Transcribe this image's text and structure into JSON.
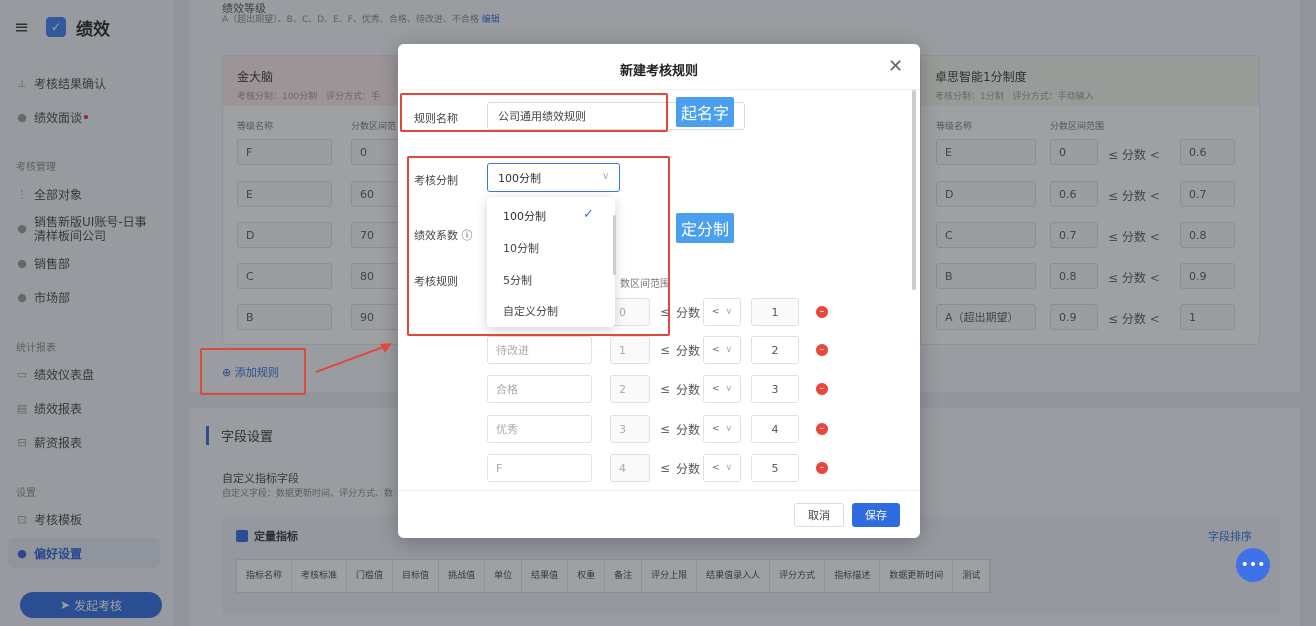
{
  "sidebar": {
    "app_title": "绩效",
    "items": [
      {
        "label": "考核结果确认",
        "icon": "stamp-icon"
      },
      {
        "label": "绩效面谈",
        "icon": "chat-icon"
      },
      {
        "label": "全部对象",
        "icon": "grid-icon"
      },
      {
        "label": "销售新版UI账号-日事清样板间公司",
        "icon": "building-icon"
      },
      {
        "label": "销售部",
        "icon": "dept-icon"
      },
      {
        "label": "市场部",
        "icon": "dept-icon"
      },
      {
        "label": "绩效仪表盘",
        "icon": "dashboard-icon"
      },
      {
        "label": "绩效报表",
        "icon": "report-icon"
      },
      {
        "label": "薪资报表",
        "icon": "salary-icon"
      },
      {
        "label": "考核模板",
        "icon": "template-icon"
      },
      {
        "label": "偏好设置",
        "icon": "settings-icon"
      }
    ],
    "sections": {
      "manage": "考核管理",
      "stats": "统计报表",
      "settings": "设置"
    },
    "launch_label": "发起考核"
  },
  "main": {
    "tier_title": "绩效等级",
    "tier_desc": "A（超出期望）、B、C、D、E、F、优秀、合格、待改进、不合格",
    "tier_edit": "编辑",
    "card_left": {
      "name": "金大脑",
      "meta": "考核分制：100分制　评分方式：手",
      "col_grade": "等级名称",
      "col_range": "分数区间范",
      "rows": [
        {
          "grade": "F",
          "min": "0"
        },
        {
          "grade": "E",
          "min": "60"
        },
        {
          "grade": "D",
          "min": "70"
        },
        {
          "grade": "C",
          "min": "80"
        },
        {
          "grade": "B",
          "min": "90"
        }
      ]
    },
    "card_right": {
      "name": "卓思智能1分制度",
      "meta": "考核分制：1分制　评分方式：手动输入",
      "col_grade": "等级名称",
      "col_range": "分数区间范围",
      "score_word": "分数",
      "rows": [
        {
          "grade": "E",
          "min": "0",
          "max": "0.6"
        },
        {
          "grade": "D",
          "min": "0.6",
          "max": "0.7"
        },
        {
          "grade": "C",
          "min": "0.7",
          "max": "0.8"
        },
        {
          "grade": "B",
          "min": "0.8",
          "max": "0.9"
        },
        {
          "grade": "A（超出期望）",
          "min": "0.9",
          "max": "1"
        }
      ]
    },
    "add_rule": "添加规则",
    "field_settings": "字段设置",
    "custom_field_title": "自定义指标字段",
    "custom_field_desc": "自定义字段：数据更新时间、评分方式、数",
    "quant_label": "定量指标",
    "sort_label": "字段排序",
    "quant_headers": [
      "指标名称",
      "考核标准",
      "门槛值",
      "目标值",
      "挑战值",
      "单位",
      "结果值",
      "权重",
      "备注",
      "评分上限",
      "结果值录入人",
      "评分方式",
      "指标描述",
      "数据更新时间",
      "测试"
    ]
  },
  "modal": {
    "title": "新建考核规则",
    "rule_name_label": "规则名称",
    "rule_name_value": "公司通用绩效规则",
    "scale_label": "考核分制",
    "scale_value": "100分制",
    "coef_label": "绩效系数",
    "rule_label": "考核规则",
    "range_header": "数区间范围",
    "score_word": "分数",
    "lt": "<",
    "le": "≤",
    "rows": [
      {
        "grade": "",
        "min": "0",
        "max": "1"
      },
      {
        "grade": "待改进",
        "min": "1",
        "max": "2"
      },
      {
        "grade": "合格",
        "min": "2",
        "max": "3"
      },
      {
        "grade": "优秀",
        "min": "3",
        "max": "4"
      },
      {
        "grade": "F",
        "min": "4",
        "max": "5"
      }
    ],
    "options": [
      "100分制",
      "10分制",
      "5分制",
      "自定义分制"
    ],
    "cancel": "取消",
    "save": "保存"
  },
  "annotations": {
    "name_tag": "起名字",
    "scale_tag": "定分制"
  }
}
